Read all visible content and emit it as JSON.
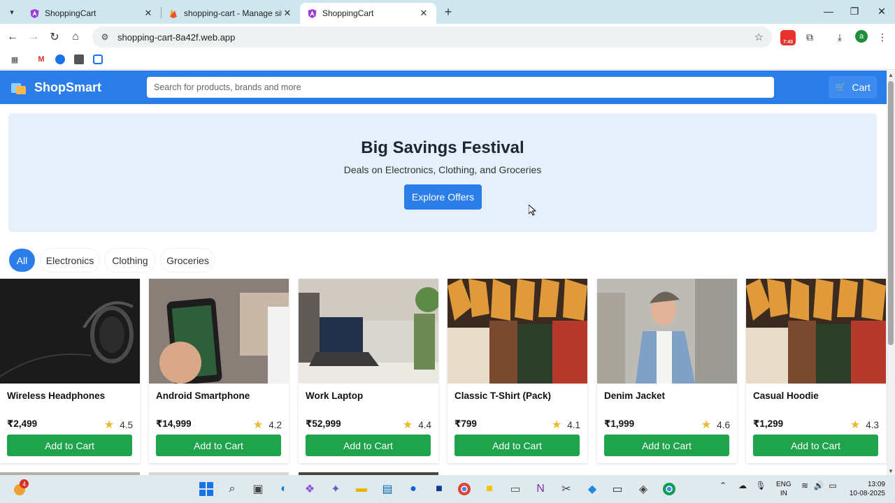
{
  "browser": {
    "tabs": [
      {
        "title": "ShoppingCart",
        "active": false
      },
      {
        "title": "shopping-cart - Manage site - F",
        "active": false
      },
      {
        "title": "ShoppingCart",
        "active": true
      }
    ],
    "url": "shopping-cart-8a42f.web.app",
    "extension_badge": "7:43",
    "profile_initial": "a"
  },
  "header": {
    "brand": "ShopSmart",
    "search_placeholder": "Search for products, brands and more",
    "cart_label": "Cart"
  },
  "hero": {
    "title": "Big Savings Festival",
    "subtitle": "Deals on Electronics, Clothing, and Groceries",
    "button": "Explore Offers"
  },
  "filters": [
    "All",
    "Electronics",
    "Clothing",
    "Groceries"
  ],
  "products": [
    {
      "name": "Wireless Headphones",
      "price": "₹2,499",
      "rating": "4.5",
      "button": "Add to Cart"
    },
    {
      "name": "Android Smartphone",
      "price": "₹14,999",
      "rating": "4.2",
      "button": "Add to Cart"
    },
    {
      "name": "Work Laptop",
      "price": "₹52,999",
      "rating": "4.4",
      "button": "Add to Cart"
    },
    {
      "name": "Classic T-Shirt (Pack)",
      "price": "₹799",
      "rating": "4.1",
      "button": "Add to Cart"
    },
    {
      "name": "Denim Jacket",
      "price": "₹1,999",
      "rating": "4.6",
      "button": "Add to Cart"
    },
    {
      "name": "Casual Hoodie",
      "price": "₹1,299",
      "rating": "4.3",
      "button": "Add to Cart"
    }
  ],
  "taskbar": {
    "notification_count": "4",
    "lang_top": "ENG",
    "lang_bottom": "IN",
    "time": "13:09",
    "date": "10-08-2025"
  },
  "colors": {
    "primary": "#2b7de9",
    "add_to_cart": "#1fa34d",
    "hero_bg": "#e6f0fb",
    "star": "#e8b92a"
  }
}
